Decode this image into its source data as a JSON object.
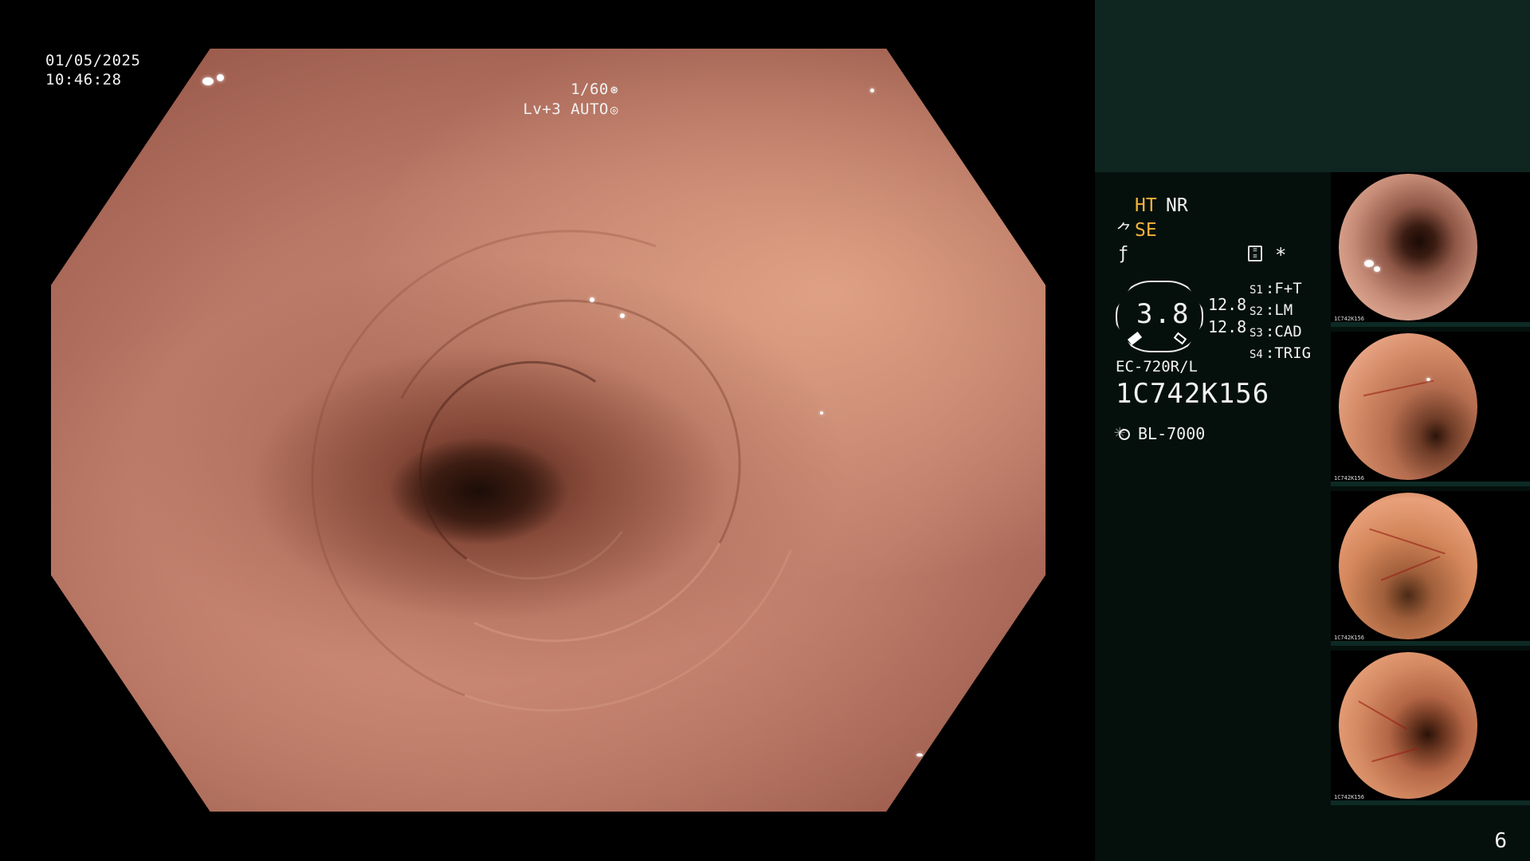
{
  "overlay": {
    "date": "01/05/2025",
    "time": "10:46:28",
    "shutter": "1/60",
    "shutter_icon": "aperture-icon",
    "level": "Lv+3",
    "mode": "AUTO",
    "mode_icon": "auto-exposure-icon"
  },
  "panel": {
    "ht": "HT",
    "nr": "NR",
    "se": "SE",
    "asterisk": "*",
    "gauge_value": "3.8",
    "num_a": "12.8",
    "num_b": "12.8",
    "slots": [
      {
        "key": "S1",
        "value": "F+T"
      },
      {
        "key": "S2",
        "value": "LM"
      },
      {
        "key": "S3",
        "value": "CAD"
      },
      {
        "key": "S4",
        "value": "TRIG"
      }
    ],
    "scope_model": "EC-720R/L",
    "scope_serial": "1C742K156",
    "light_source": "BL-7000",
    "thumbnails": [
      {
        "serial": "1C742K156"
      },
      {
        "serial": "1C742K156"
      },
      {
        "serial": "1C742K156"
      },
      {
        "serial": "1C742K156"
      }
    ],
    "accent_color": "#f4b43a",
    "panel_color": "#0f2520"
  },
  "page_number": "6"
}
